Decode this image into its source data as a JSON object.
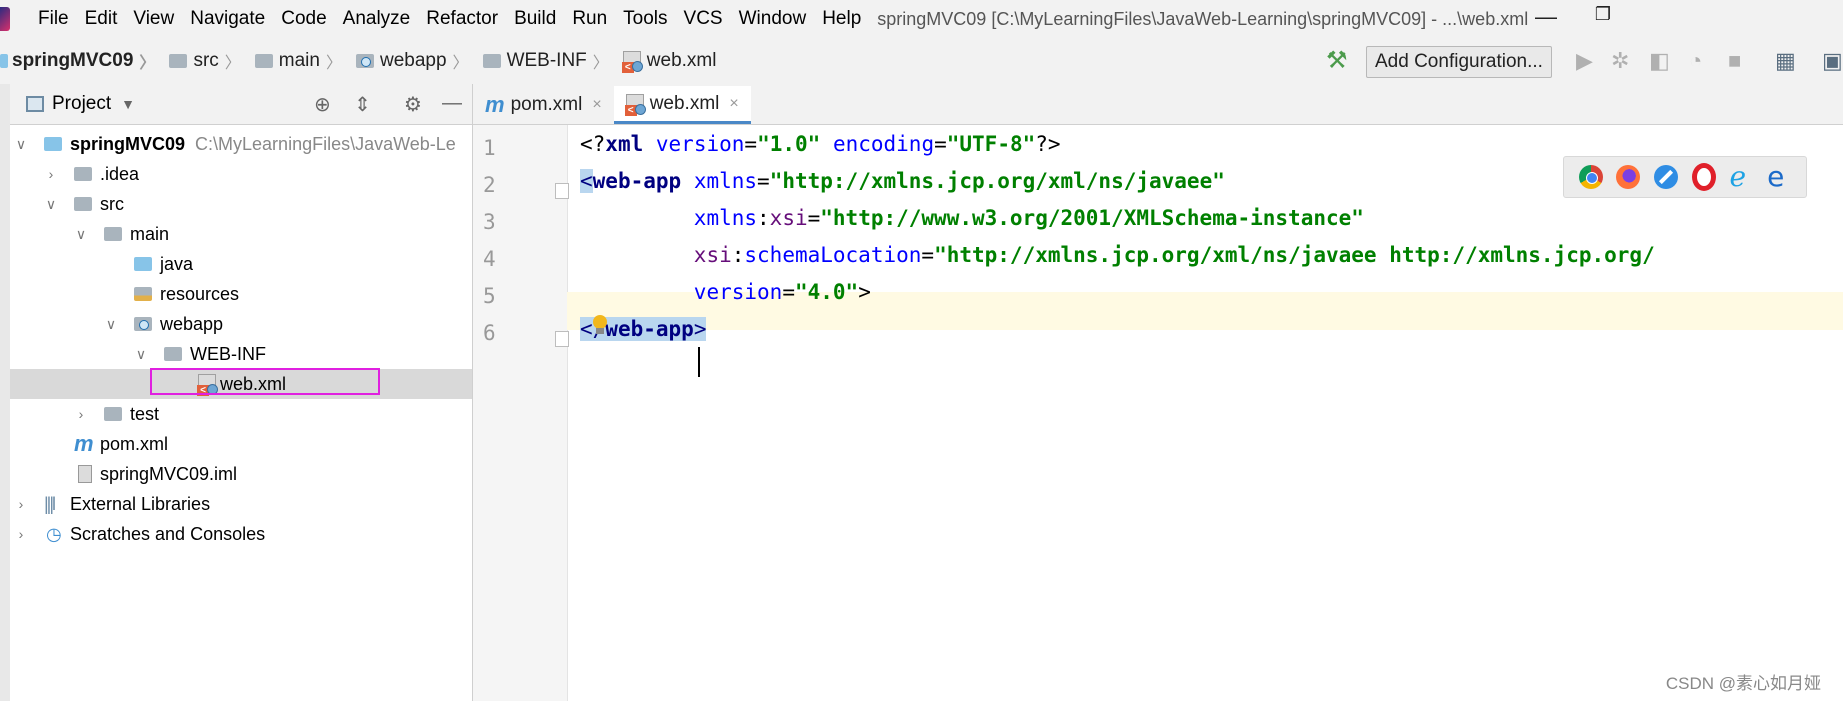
{
  "menubar": {
    "items": [
      "File",
      "Edit",
      "View",
      "Navigate",
      "Code",
      "Analyze",
      "Refactor",
      "Build",
      "Run",
      "Tools",
      "VCS",
      "Window",
      "Help"
    ],
    "window_title": "springMVC09 [C:\\MyLearningFiles\\JavaWeb-Learning\\springMVC09] - ...\\web.xml"
  },
  "breadcrumb": [
    "springMVC09",
    "src",
    "main",
    "webapp",
    "WEB-INF",
    "web.xml"
  ],
  "toolbar": {
    "add_config_label": "Add Configuration..."
  },
  "project_panel": {
    "title": "Project",
    "root_path_hint": "C:\\MyLearningFiles\\JavaWeb-Le",
    "tree": [
      {
        "label": "springMVC09",
        "bold": true
      },
      {
        "label": ".idea"
      },
      {
        "label": "src"
      },
      {
        "label": "main"
      },
      {
        "label": "java"
      },
      {
        "label": "resources"
      },
      {
        "label": "webapp"
      },
      {
        "label": "WEB-INF"
      },
      {
        "label": "web.xml"
      },
      {
        "label": "test"
      },
      {
        "label": "pom.xml"
      },
      {
        "label": "springMVC09.iml"
      },
      {
        "label": "External Libraries"
      },
      {
        "label": "Scratches and Consoles"
      }
    ]
  },
  "editor": {
    "tabs": [
      {
        "label": "pom.xml",
        "close": "×"
      },
      {
        "label": "web.xml",
        "close": "×"
      }
    ],
    "line_numbers": [
      "1",
      "2",
      "3",
      "4",
      "5",
      "6"
    ],
    "line1": {
      "open": "<?",
      "tag": "xml",
      "a1": "version",
      "v1": "\"1.0\"",
      "a2": "encoding",
      "v2": "\"UTF-8\"",
      "close": "?>"
    },
    "line2": {
      "lt": "<",
      "tag": "web-app",
      "attr": "xmlns",
      "val": "\"http://xmlns.jcp.org/xml/ns/javaee\""
    },
    "line3": {
      "ns": "xmlns",
      "colon": ":",
      "attr": "xsi",
      "val": "\"http://www.w3.org/2001/XMLSchema-instance\""
    },
    "line4": {
      "ns": "xsi",
      "colon": ":",
      "attr": "schemaLocation",
      "val": "\"http://xmlns.jcp.org/xml/ns/javaee http://xmlns.jcp.org/"
    },
    "line5": {
      "attr": "version",
      "val": "\"4.0\"",
      "close": ">"
    },
    "line6": {
      "lt": "</",
      "tag": "web-app",
      "gt": ">"
    }
  },
  "watermark": "CSDN @素心如月娅",
  "colors": {
    "xml_string": "#008000",
    "xml_tag": "#000080",
    "xml_attr": "#0000ff",
    "xml_ns": "#660e7a",
    "accent": "#4a88c7",
    "highlight_box": "#e020e0"
  }
}
